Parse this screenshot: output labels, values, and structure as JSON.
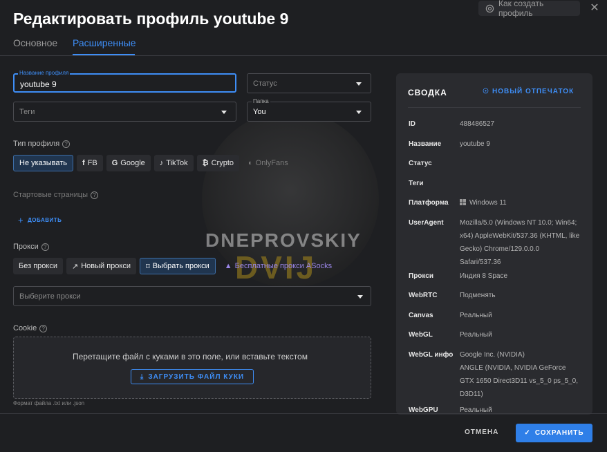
{
  "header": {
    "title": "Редактировать профиль youtube 9",
    "help_button": "Как создать профиль",
    "close_icon": "close-icon",
    "tabs": [
      {
        "label": "Основное",
        "active": false
      },
      {
        "label": "Расширенные",
        "active": true
      }
    ]
  },
  "form": {
    "profile_name": {
      "label": "Название профиля",
      "value": "youtube 9"
    },
    "status": {
      "placeholder": "Статус"
    },
    "tags": {
      "placeholder": "Теги"
    },
    "folder": {
      "label": "Папка",
      "value": "You"
    },
    "profile_type": {
      "label": "Тип профиля",
      "options": [
        "Не указывать",
        "FB",
        "Google",
        "TikTok",
        "Crypto",
        "OnlyFans"
      ],
      "selected": "Не указывать"
    },
    "start_pages": {
      "label": "Стартовые страницы",
      "add_label": "ДОБАВИТЬ"
    },
    "proxy": {
      "label": "Прокси",
      "options": [
        "Без прокси",
        "Новый прокси",
        "Выбрать прокси",
        "Бесплатные прокси ASocks"
      ],
      "selected": "Выбрать прокси",
      "select_placeholder": "Выберите прокси"
    },
    "cookie": {
      "label": "Cookie",
      "drop_text": "Перетащите файл с куками в это поле, или вставьте текстом",
      "upload_label": "ЗАГРУЗИТЬ ФАЙЛ КУКИ",
      "format_hint": "Формат файла .txt или .json"
    }
  },
  "watermark": {
    "line1": "DNEPROVSKIY",
    "line2": "DVIJ"
  },
  "summary": {
    "title": "СВОДКА",
    "fingerprint_label": "НОВЫЙ ОТПЕЧАТОК",
    "rows": [
      {
        "key": "ID",
        "value": "488486527"
      },
      {
        "key": "Название",
        "value": "youtube 9"
      },
      {
        "key": "Статус",
        "value": ""
      },
      {
        "key": "Теги",
        "value": ""
      },
      {
        "key": "Платформа",
        "value": "Windows 11"
      },
      {
        "key": "UserAgent",
        "value": "Mozilla/5.0 (Windows NT 10.0; Win64; x64) AppleWebKit/537.36 (KHTML, like Gecko) Chrome/129.0.0.0 Safari/537.36"
      },
      {
        "key": "Прокси",
        "value": "Индия 8 Space"
      },
      {
        "key": "WebRTC",
        "value": "Подменять"
      },
      {
        "key": "Canvas",
        "value": "Реальный"
      },
      {
        "key": "WebGL",
        "value": "Реальный"
      },
      {
        "key": "WebGL инфо",
        "value": "Google Inc. (NVIDIA)",
        "value2": "ANGLE (NVIDIA, NVIDIA GeForce GTX 1650 Direct3D11 vs_5_0 ps_5_0, D3D11)"
      },
      {
        "key": "WebGPU",
        "value": "Реальный"
      }
    ]
  },
  "footer": {
    "cancel_label": "ОТМЕНА",
    "save_label": "СОХРАНИТЬ"
  },
  "colors": {
    "accent": "#3e8ef7",
    "background": "#1e1f22",
    "panel": "#2a2b2f"
  }
}
